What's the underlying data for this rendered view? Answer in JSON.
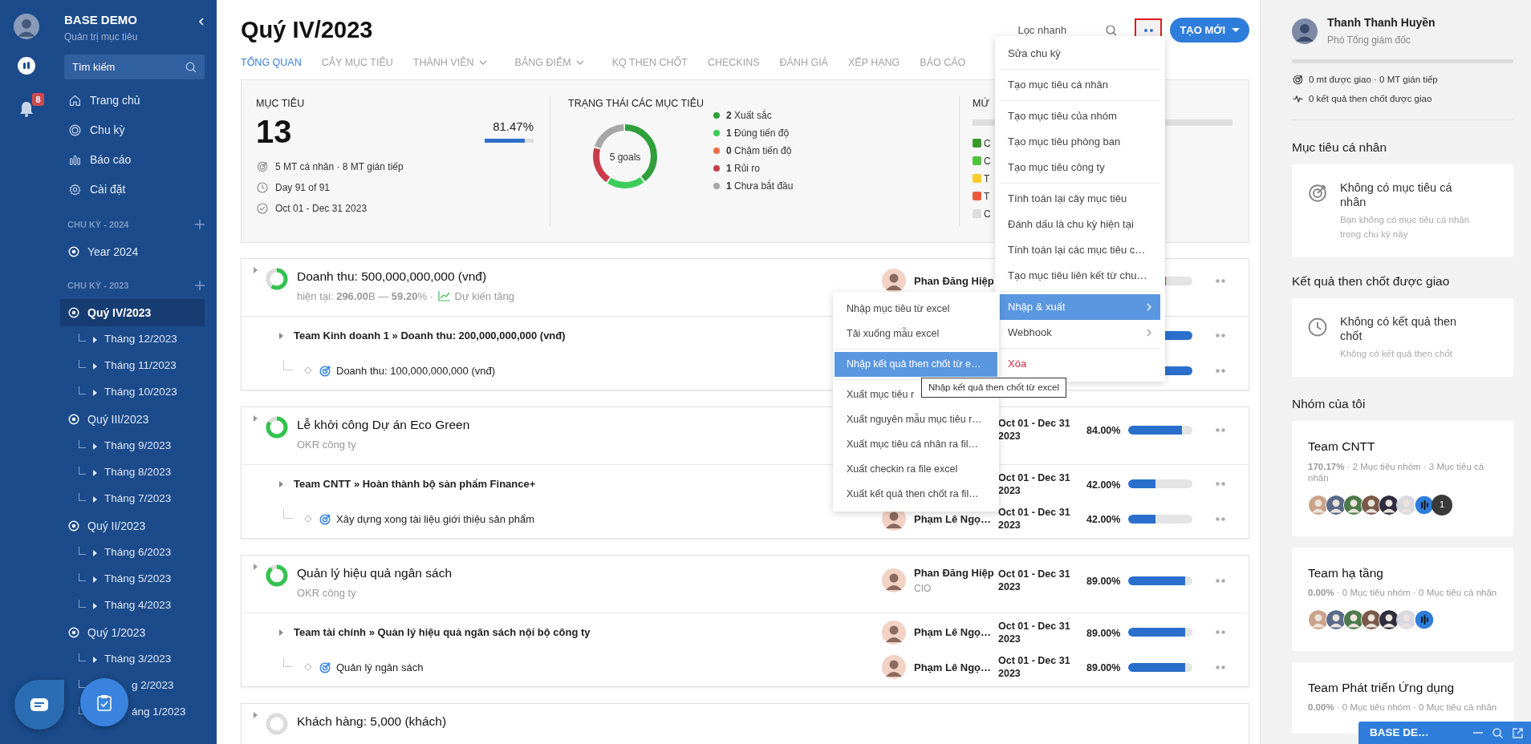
{
  "sidebar": {
    "brand": "BASE DEMO",
    "subtitle": "Quản trị mục tiêu",
    "search_placeholder": "Tìm kiếm",
    "notification_count": "8",
    "nav": [
      {
        "label": "Trang chủ",
        "kind": "home"
      },
      {
        "label": "Chu kỳ",
        "kind": "cycle"
      },
      {
        "label": "Báo cáo",
        "kind": "report"
      },
      {
        "label": "Cài đặt",
        "kind": "settings"
      }
    ],
    "groups": [
      {
        "title": "CHU KỲ - 2024",
        "cycles": [
          {
            "label": "Year 2024",
            "selected": false
          }
        ]
      },
      {
        "title": "CHU KỲ - 2023",
        "cycles": [
          {
            "label": "Quý IV/2023",
            "selected": true,
            "children": [
              "Tháng 12/2023",
              "Tháng 11/2023",
              "Tháng 10/2023"
            ]
          },
          {
            "label": "Quý III/2023",
            "selected": false,
            "children": [
              "Tháng 9/2023",
              "Tháng 8/2023",
              "Tháng 7/2023"
            ]
          },
          {
            "label": "Quý II/2023",
            "selected": false,
            "children": [
              "Tháng 6/2023",
              "Tháng 5/2023",
              "Tháng 4/2023"
            ]
          },
          {
            "label": "Quý 1/2023",
            "selected": false,
            "children": [
              "Tháng 3/2023",
              {
                "label": "g 2/2023",
                "covered": true
              },
              {
                "label": "áng 1/2023",
                "covered": true
              }
            ]
          }
        ]
      }
    ]
  },
  "header": {
    "title": "Quý IV/2023",
    "quick_filter_placeholder": "Lọc nhanh",
    "create_button": "TẠO MỚI",
    "tabs": [
      {
        "label": "TỔNG QUAN",
        "selected": true
      },
      {
        "label": "CÂY MỤC TIÊU",
        "selected": false
      },
      {
        "label": "THÀNH VIÊN",
        "selected": false,
        "dropdown": true
      },
      {
        "label": "BẢNG ĐIỂM",
        "selected": false,
        "dropdown": true
      },
      {
        "label": "KQ THEN CHỐT",
        "selected": false
      },
      {
        "label": "CHECKINS",
        "selected": false
      },
      {
        "label": "ĐÁNH GIÁ",
        "selected": false
      },
      {
        "label": "XẾP HẠNG",
        "selected": false
      },
      {
        "label": "BÁO CÁO",
        "selected": false
      }
    ]
  },
  "summary": {
    "objectives": {
      "title": "MỤC TIÊU",
      "count": "13",
      "percent": "81.47%",
      "level": 0.8147,
      "details": [
        {
          "kind": "target",
          "text": "5 MT cá nhân · 8 MT gián tiếp"
        },
        {
          "kind": "clock",
          "text": "Day 91 of 91"
        },
        {
          "kind": "check",
          "text": "Oct 01 - Dec 31 2023"
        }
      ]
    },
    "status": {
      "title": "TRẠNG THÁI CÁC MỤC TIÊU",
      "center": "5 goals",
      "legend": [
        {
          "count": "2",
          "label": "Xuất sắc",
          "color": "#30a03c"
        },
        {
          "count": "1",
          "label": "Đúng tiến độ",
          "color": "#3ccd5a"
        },
        {
          "count": "0",
          "label": "Chậm tiến độ",
          "color": "#ef6a45"
        },
        {
          "count": "1",
          "label": "Rủi ro",
          "color": "#c93c4c"
        },
        {
          "count": "1",
          "label": "Chưa bắt đầu",
          "color": "#a6a6a6"
        }
      ]
    },
    "levels": {
      "title": "MỨ",
      "legend": [
        {
          "label": "C",
          "color": "#3a9a2a"
        },
        {
          "label": "C",
          "color": "#52c23a"
        },
        {
          "label": "T",
          "color": "#f8cb2e"
        },
        {
          "label": "T",
          "color": "#ea5a3a"
        },
        {
          "label": "C",
          "color": "#dddddd"
        }
      ]
    }
  },
  "goals": [
    {
      "title": "Doanh thu: 500,000,000,000 (vnđ)",
      "subtitle": "hiện tại: **296.00**B — **59.20**% · ",
      "trend": "Dự kiến tăng",
      "level": 0.592,
      "owner": {
        "name": "Phan Đăng Hiệp"
      },
      "children": [
        {
          "kind": "team",
          "text": "Team Kinh doanh 1 » Doanh thu: 200,000,000,000 (vnđ)",
          "level": 1
        },
        {
          "kind": "key_result",
          "text": "Doanh thu: 100,000,000,000 (vnđ)",
          "level": 1
        }
      ]
    },
    {
      "title": "Lễ khởi công Dự án Eco Green",
      "subtitle": "OKR công ty",
      "level": 0.84,
      "date": "Oct 01 - Dec 31 2023",
      "percent": "84.00%",
      "children": [
        {
          "kind": "team",
          "text": "Team CNTT » Hoàn thành bộ sản phẩm Finance+",
          "level": 0.42,
          "date": "Oct 01 - Dec 31 2023",
          "percent": "42.00%"
        },
        {
          "kind": "key_result",
          "text": "Xây dựng xong tài liệu giới thiệu sản phẩm",
          "level": 0.42,
          "owner": {
            "name": "Phạm Lê Ngọ…"
          },
          "date": "Oct 01 - Dec 31 2023",
          "percent": "42.00%"
        }
      ]
    },
    {
      "title": "Quản lý hiệu quả ngân sách",
      "subtitle": "OKR công ty",
      "level": 0.89,
      "owner": {
        "name": "Phan Đăng Hiệp",
        "role": "CIO"
      },
      "date": "Oct 01 - Dec 31 2023",
      "percent": "89.00%",
      "children": [
        {
          "kind": "team",
          "text": "Team tài chính » Quản lý hiệu quả ngân sách nội bộ công ty",
          "level": 0.89,
          "owner": {
            "name": "Phạm Lê Ngọ…"
          },
          "date": "Oct 01 - Dec 31 2023",
          "percent": "89.00%"
        },
        {
          "kind": "key_result",
          "text": "Quản lý ngân sách",
          "level": 0.89,
          "owner": {
            "name": "Phạm Lê Ngọ…"
          },
          "date": "Oct 01 - Dec 31 2023",
          "percent": "89.00%"
        }
      ]
    },
    {
      "title": "Khách hàng: 5,000 (khách)"
    }
  ],
  "menu": [
    {
      "label": "Sửa chu kỳ",
      "kind": "item",
      "selected": false,
      "divider_after": true
    },
    {
      "label": "Tạo mục tiêu cá nhân",
      "kind": "item",
      "selected": false,
      "divider_after": true
    },
    {
      "label": "Tạo mục tiêu của nhóm",
      "kind": "item",
      "selected": false,
      "divider_after": false
    },
    {
      "label": "Tạo mục tiêu phòng ban",
      "kind": "item",
      "selected": false,
      "divider_after": false
    },
    {
      "label": "Tạo mục tiêu công ty",
      "kind": "item",
      "selected": false,
      "divider_after": true
    },
    {
      "label": "Tính toán lại cây mục tiêu",
      "kind": "item",
      "selected": false,
      "divider_after": false
    },
    {
      "label": "Đánh dấu là chu kỳ hiện tại",
      "kind": "item",
      "selected": false,
      "divider_after": false
    },
    {
      "label": "Tính toán lại các mục tiêu c…",
      "kind": "item",
      "selected": false,
      "divider_after": false
    },
    {
      "label": "Tạo mục tiêu liên kết từ chu…",
      "kind": "item",
      "selected": false,
      "divider_after": true
    },
    {
      "label": "Nhập & xuất",
      "kind": "submenu",
      "selected": true,
      "divider_after": false
    },
    {
      "label": "Webhook",
      "kind": "submenu",
      "selected": false,
      "divider_after": true
    },
    {
      "label": "Xóa",
      "kind": "danger",
      "selected": false,
      "divider_after": false
    }
  ],
  "submenu": [
    {
      "label": "Nhập mục tiêu từ excel",
      "selected": false,
      "divider_after": false
    },
    {
      "label": "Tải xuống mẫu excel",
      "selected": false,
      "divider_after": true
    },
    {
      "label": "Nhập kết quả then chốt từ e…",
      "selected": true,
      "divider_after": true
    },
    {
      "label": "Xuất mục tiêu r",
      "selected": false,
      "divider_after": false
    },
    {
      "label": "Xuất nguyên mẫu mục tiêu r…",
      "selected": false,
      "divider_after": false
    },
    {
      "label": "Xuất mục tiêu cá nhân ra fil…",
      "selected": false,
      "divider_after": false
    },
    {
      "label": "Xuất checkin ra file excel",
      "selected": false,
      "divider_after": false
    },
    {
      "label": "Xuất kết quả then chốt ra fil…",
      "selected": false,
      "divider_after": false
    }
  ],
  "tooltip": "Nhập kết quả then chốt từ excel",
  "profile": {
    "name": "Thanh Thanh Huyền",
    "role": "Phó Tổng giám đốc",
    "level": 0,
    "stats": [
      {
        "kind": "target",
        "text": "0 mt được giao · 0 MT gián tiếp"
      },
      {
        "kind": "pulse",
        "text": "0 kết quả then chốt được giao"
      }
    ],
    "sections": [
      {
        "title": "Mục tiêu cá nhân",
        "kind": "target",
        "empty_title": "Không có mục tiêu cá nhân",
        "empty_text": "Bạn không có mục tiêu cá nhân trong chu kỳ này"
      },
      {
        "title": "Kết quả then chốt được giao",
        "kind": "clock",
        "empty_title": "Không có kết quả then chốt",
        "empty_text": "Không có kết quả then chốt"
      }
    ],
    "teams_title": "Nhóm của tôi",
    "teams": [
      {
        "name": "Team CNTT",
        "stats": "**170.17%** · 2 Mục tiêu nhóm · 3 Mục tiêu cá nhân",
        "members": [
          {
            "kind": "photo"
          },
          {
            "kind": "photo"
          },
          {
            "kind": "photo"
          },
          {
            "kind": "photo"
          },
          {
            "kind": "photo"
          },
          {
            "kind": "photo"
          },
          {
            "kind": "voice"
          }
        ],
        "extra": "1"
      },
      {
        "name": "Team hạ tầng",
        "stats": "**0.00%** · 0 Mục tiêu nhóm · 0 Mục tiêu cá nhân",
        "members": [
          {
            "kind": "photo"
          },
          {
            "kind": "photo"
          },
          {
            "kind": "photo"
          },
          {
            "kind": "photo"
          },
          {
            "kind": "photo"
          },
          {
            "kind": "photo"
          },
          {
            "kind": "voice"
          }
        ]
      },
      {
        "name": "Team Phát triển Ứng dụng",
        "stats": "**0.00%** · 0 Mục tiêu nhóm · 0 Mục tiêu cá nhân"
      }
    ]
  },
  "chat_bar": {
    "title": "BASE DE…"
  }
}
